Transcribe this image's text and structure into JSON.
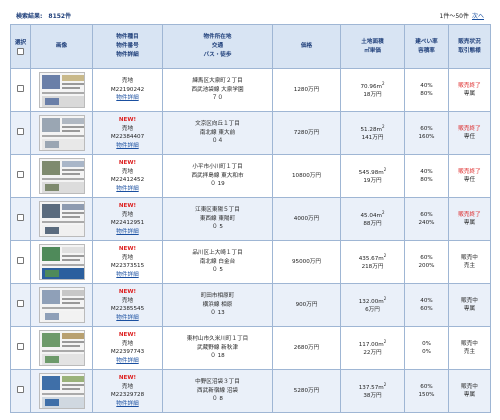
{
  "summary": {
    "label": "検索結果:",
    "count": "8152件"
  },
  "pager": {
    "range": "1件～50件",
    "next": "次へ"
  },
  "table": {
    "headers": {
      "select": "選択",
      "image": "画像",
      "property": [
        "物件種目",
        "物件番号",
        "物件詳細"
      ],
      "location": [
        "物件所在地",
        "交通",
        "バス・徒歩"
      ],
      "price": "価格",
      "land": [
        "土地面積",
        "㎡単価"
      ],
      "ratio": [
        "建ぺい率",
        "容積率"
      ],
      "status": [
        "販売状況",
        "取引態様"
      ]
    },
    "rows": [
      {
        "new": "",
        "type": "売地",
        "number": "M22190242",
        "detail": "物件詳細",
        "address": "練馬区大泉町２丁目",
        "line": "西武池袋線 大泉学園",
        "walk": "７０",
        "price": "1280万円",
        "area": "70.96m",
        "unit": "18万円",
        "coverage": "40%",
        "floor": "80%",
        "status": "販売終了",
        "status_red": true,
        "deal": "専属"
      },
      {
        "new": "NEW!",
        "type": "売地",
        "number": "M22384407",
        "detail": "物件詳細",
        "address": "文京区向丘１丁目",
        "line": "南北線 東大前",
        "walk": "０４",
        "price": "7280万円",
        "area": "51.28m",
        "unit": "141万円",
        "coverage": "60%",
        "floor": "160%",
        "status": "販売終了",
        "status_red": true,
        "deal": "専任"
      },
      {
        "new": "NEW!",
        "type": "売地",
        "number": "M22412452",
        "detail": "物件詳細",
        "address": "小平市小川町１丁目",
        "line": "西武拝島線 東大和市",
        "walk": "０ 19",
        "price": "10800万円",
        "area": "545.98m",
        "unit": "19万円",
        "coverage": "40%",
        "floor": "80%",
        "status": "販売終了",
        "status_red": true,
        "deal": "専任"
      },
      {
        "new": "NEW!",
        "type": "売地",
        "number": "M22412951",
        "detail": "物件詳細",
        "address": "江東区東陽５丁目",
        "line": "東西線 東陽町",
        "walk": "０ 5",
        "price": "4000万円",
        "area": "45.04m",
        "unit": "88万円",
        "coverage": "60%",
        "floor": "240%",
        "status": "販売終了",
        "status_red": true,
        "deal": "専属"
      },
      {
        "new": "NEW!",
        "type": "売地",
        "number": "M22373515",
        "detail": "物件詳細",
        "address": "品川区上大崎１丁目",
        "line": "南北線 白金台",
        "walk": "０ 5",
        "price": "95000万円",
        "area": "435.67m",
        "unit": "218万円",
        "coverage": "60%",
        "floor": "200%",
        "status": "販売中",
        "status_red": false,
        "deal": "売主"
      },
      {
        "new": "NEW!",
        "type": "売地",
        "number": "M22385545",
        "detail": "物件詳細",
        "address": "町田市相原町",
        "line": "横浜線 相原",
        "walk": "０ 13",
        "price": "900万円",
        "area": "132.00m",
        "unit": "6万円",
        "coverage": "40%",
        "floor": "60%",
        "status": "販売中",
        "status_red": false,
        "deal": "専属"
      },
      {
        "new": "NEW!",
        "type": "売地",
        "number": "M22397743",
        "detail": "物件詳細",
        "address": "東村山市久米川町１丁目",
        "line": "武蔵野線 新秋津",
        "walk": "０ 18",
        "price": "2680万円",
        "area": "117.00m",
        "unit": "22万円",
        "coverage": "0%",
        "floor": "0%",
        "status": "販売中",
        "status_red": false,
        "deal": "売主"
      },
      {
        "new": "NEW!",
        "type": "売地",
        "number": "M22329728",
        "detail": "物件詳細",
        "address": "中野区沼袋３丁目",
        "line": "西武新宿線 沼袋",
        "walk": "０ 8",
        "price": "5280万円",
        "area": "137.57m",
        "unit": "38万円",
        "coverage": "60%",
        "floor": "150%",
        "status": "販売中",
        "status_red": false,
        "deal": "専属"
      }
    ]
  },
  "colors": {
    "header_bg": "#d8e4f3",
    "row_alt": "#eaf0f9",
    "border": "#9fb6d4",
    "red": "#dd2222",
    "link": "#1a4fa0"
  }
}
